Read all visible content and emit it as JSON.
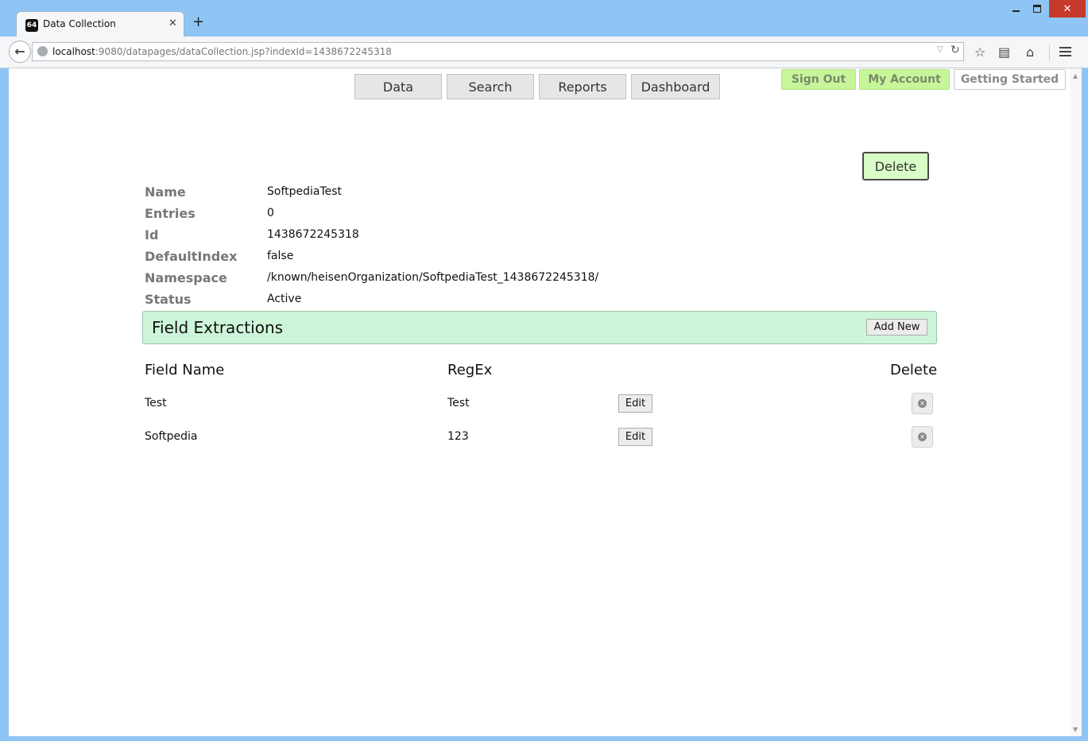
{
  "browser": {
    "tab_title": "Data Collection",
    "tab_favicon_text": "64",
    "url_host": "localhost",
    "url_path": ":9080/datapages/dataCollection.jsp?indexId=1438672245318"
  },
  "nav": {
    "items": [
      {
        "label": "Data"
      },
      {
        "label": "Search"
      },
      {
        "label": "Reports"
      },
      {
        "label": "Dashboard"
      }
    ]
  },
  "account": {
    "sign_out": "Sign Out",
    "my_account": "My Account",
    "getting_started": "Getting Started"
  },
  "delete_label": "Delete",
  "properties": [
    {
      "label": "Name",
      "value": "SoftpediaTest"
    },
    {
      "label": "Entries",
      "value": "0"
    },
    {
      "label": "Id",
      "value": "1438672245318"
    },
    {
      "label": "DefaultIndex",
      "value": "false"
    },
    {
      "label": "Namespace",
      "value": "/known/heisenOrganization/SoftpediaTest_1438672245318/"
    },
    {
      "label": "Status",
      "value": "Active"
    }
  ],
  "field_extractions": {
    "title": "Field Extractions",
    "add_new": "Add New",
    "columns": {
      "field_name": "Field Name",
      "regex": "RegEx",
      "delete": "Delete"
    },
    "rows": [
      {
        "field_name": "Test",
        "regex": "Test",
        "edit": "Edit"
      },
      {
        "field_name": "Softpedia",
        "regex": "123",
        "edit": "Edit"
      }
    ]
  }
}
